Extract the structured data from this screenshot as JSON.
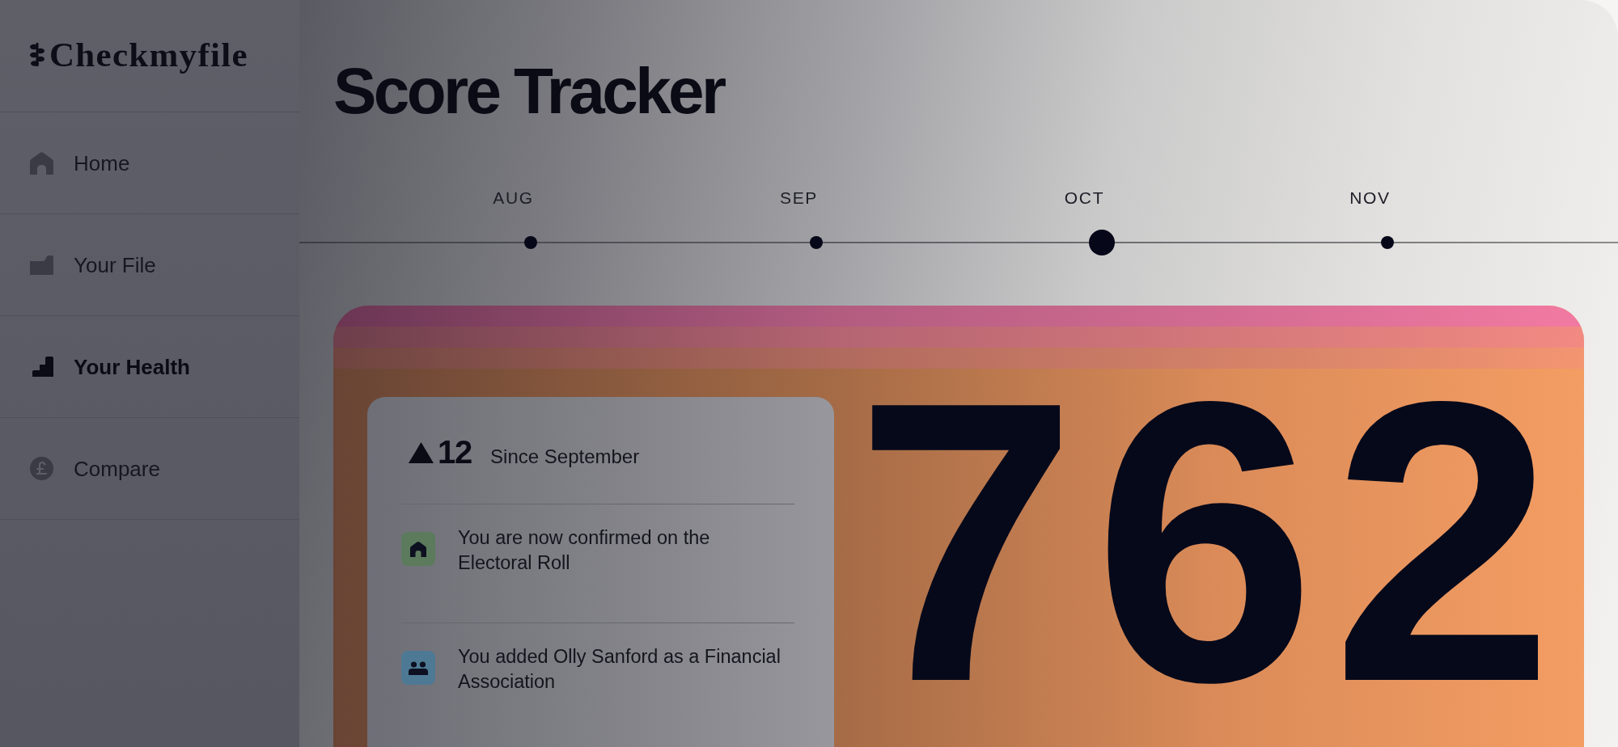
{
  "sidebar": {
    "logo": "Checkmyfile",
    "items": [
      {
        "label": "Home",
        "selected": false
      },
      {
        "label": "Your File",
        "selected": false
      },
      {
        "label": "Your Health",
        "selected": true
      },
      {
        "label": "Compare",
        "selected": false
      }
    ]
  },
  "page": {
    "title": "Score Tracker"
  },
  "timeline": {
    "months": [
      {
        "label": "AUG",
        "selected": false
      },
      {
        "label": "SEP",
        "selected": false
      },
      {
        "label": "OCT",
        "selected": true
      },
      {
        "label": "NOV",
        "selected": false
      }
    ]
  },
  "score": {
    "value": "762",
    "change": {
      "amount": "12",
      "period": "Since September"
    },
    "events": [
      {
        "text": "You are now confirmed on the Electoral Roll",
        "color": "#5b7b5c"
      },
      {
        "text": "You added Olly Sanford as a Financial Association",
        "color": "#4e7995"
      }
    ]
  }
}
